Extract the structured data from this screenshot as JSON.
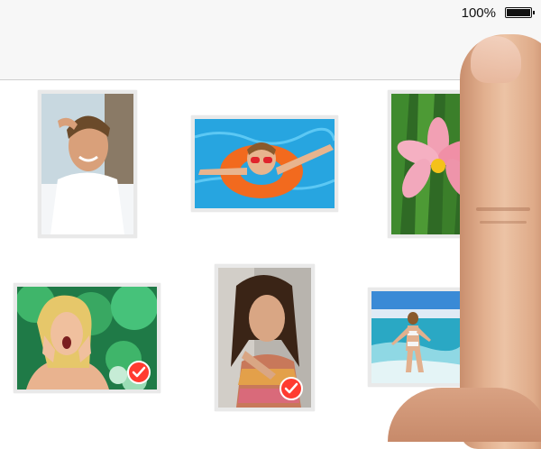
{
  "status_bar": {
    "battery_percent": "100%",
    "battery_icon": "battery-full-icon"
  },
  "nav_bar": {
    "accent_dot_color": "#ff3b30"
  },
  "photos": [
    {
      "name": "photo-smiling-man",
      "selected": false
    },
    {
      "name": "photo-girl-in-pool-float",
      "selected": false
    },
    {
      "name": "photo-pink-flower",
      "selected": false
    },
    {
      "name": "photo-surprised-woman",
      "selected": true
    },
    {
      "name": "photo-woman-portrait",
      "selected": true
    },
    {
      "name": "photo-woman-at-beach",
      "selected": false
    }
  ],
  "selection_color": "#ff3b30",
  "checkmark_icon": "checkmark-icon"
}
